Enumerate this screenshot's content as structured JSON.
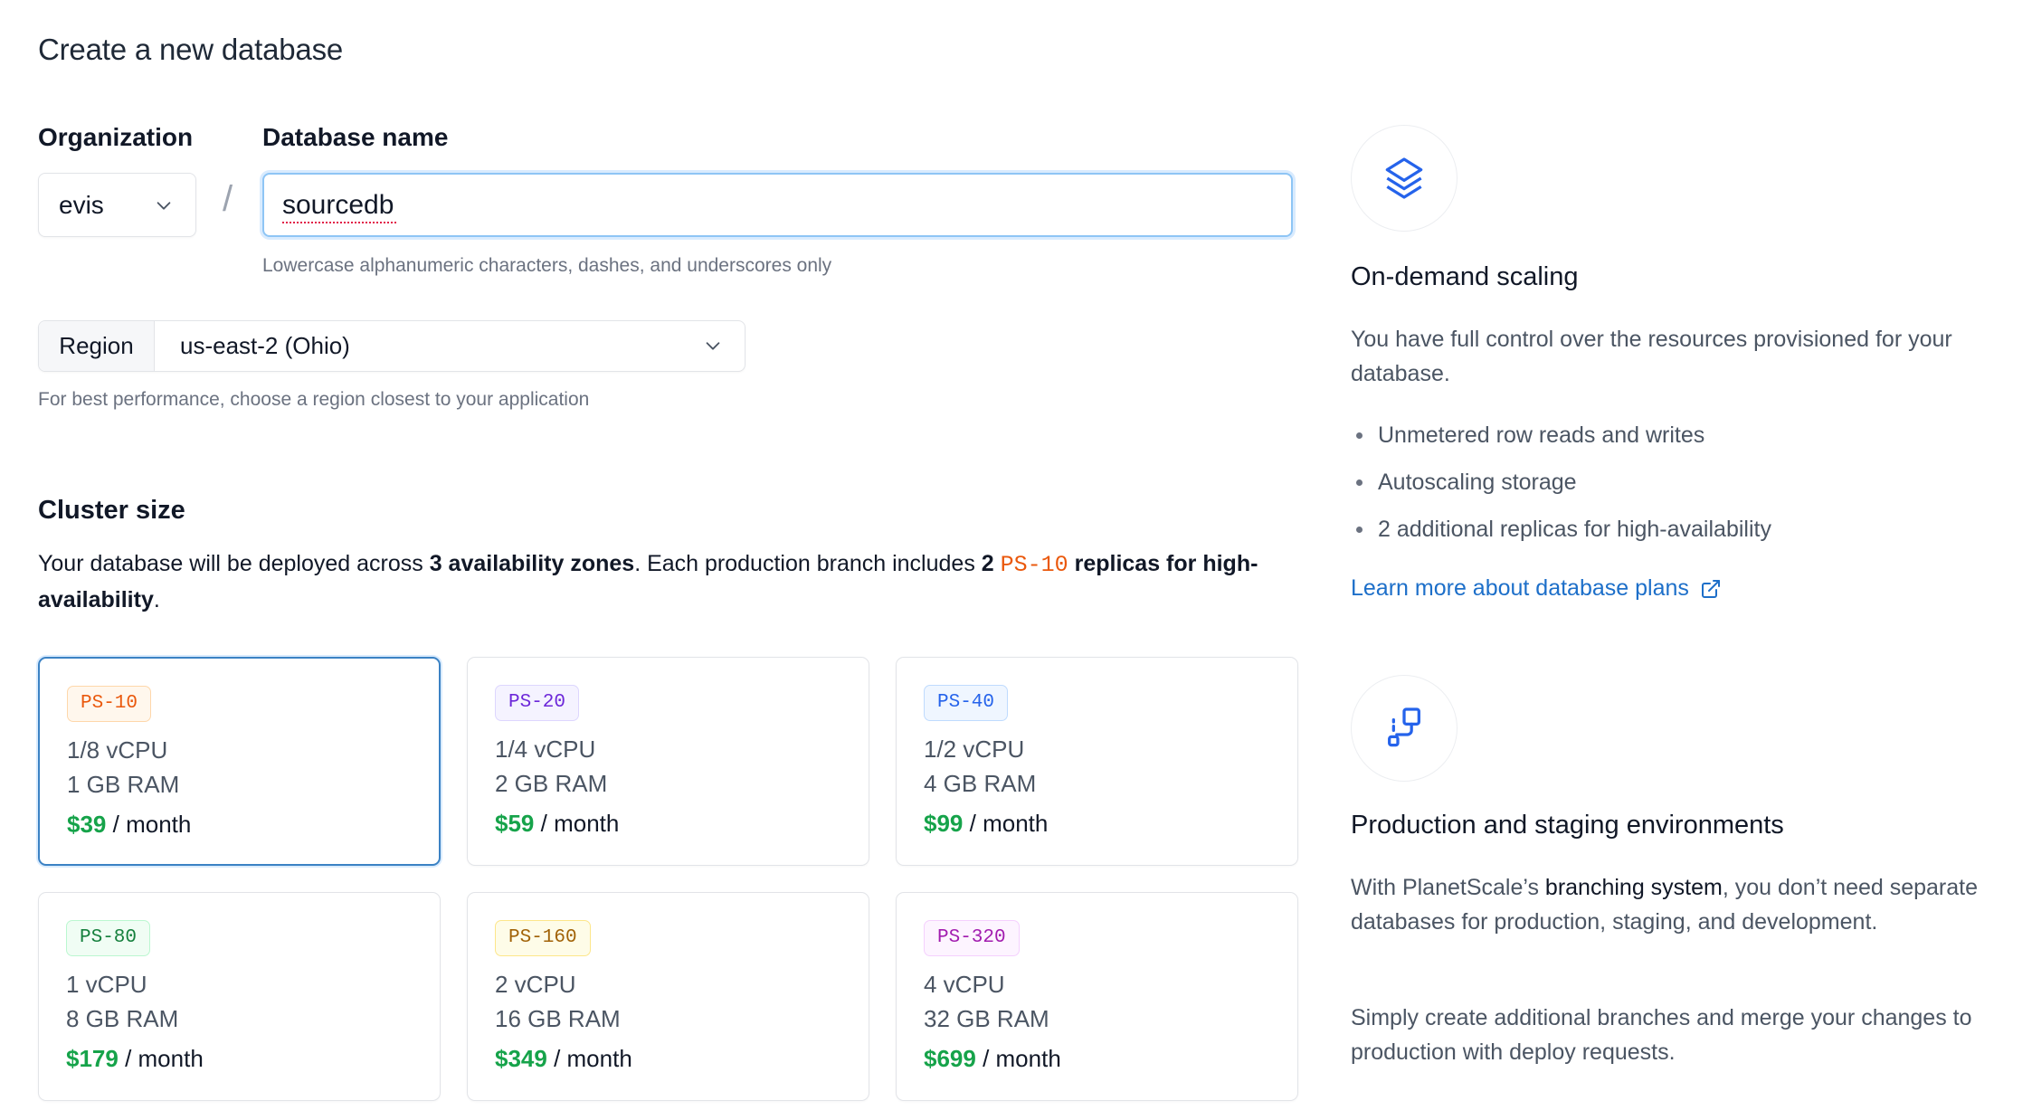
{
  "page": {
    "title": "Create a new database"
  },
  "organization": {
    "label": "Organization",
    "value": "evis"
  },
  "database": {
    "label": "Database name",
    "value": "sourcedb",
    "hint": "Lowercase alphanumeric characters, dashes, and underscores only"
  },
  "region": {
    "label": "Region",
    "value": "us-east-2 (Ohio)",
    "hint": "For best performance, choose a region closest to your application"
  },
  "cluster": {
    "title": "Cluster size",
    "desc_prefix": "Your database will be deployed across ",
    "desc_zones": "3 availability zones",
    "desc_mid": ". Each production branch includes ",
    "desc_replica_count": "2",
    "desc_replica_type": "PS-10",
    "desc_replicas": "replicas for high-availability",
    "desc_end": ".",
    "per_month": "/ month",
    "sizes": [
      {
        "name": "PS-10",
        "cpu": "1/8 vCPU",
        "ram": "1 GB RAM",
        "price": "$39",
        "color": "#ea580c",
        "bg": "#fff7ed",
        "border": "#fed7aa",
        "selected": true
      },
      {
        "name": "PS-20",
        "cpu": "1/4 vCPU",
        "ram": "2 GB RAM",
        "price": "$59",
        "color": "#6d28d9",
        "bg": "#f5f3ff",
        "border": "#ddd6fe",
        "selected": false
      },
      {
        "name": "PS-40",
        "cpu": "1/2 vCPU",
        "ram": "4 GB RAM",
        "price": "$99",
        "color": "#2563eb",
        "bg": "#eff6ff",
        "border": "#bfdbfe",
        "selected": false
      },
      {
        "name": "PS-80",
        "cpu": "1 vCPU",
        "ram": "8 GB RAM",
        "price": "$179",
        "color": "#15803d",
        "bg": "#f0fdf4",
        "border": "#bbf7d0",
        "selected": false
      },
      {
        "name": "PS-160",
        "cpu": "2 vCPU",
        "ram": "16 GB RAM",
        "price": "$349",
        "color": "#a16207",
        "bg": "#fefce8",
        "border": "#fde68a",
        "selected": false
      },
      {
        "name": "PS-320",
        "cpu": "4 vCPU",
        "ram": "32 GB RAM",
        "price": "$699",
        "color": "#a21caf",
        "bg": "#fdf4ff",
        "border": "#f5d0fe",
        "selected": false
      }
    ]
  },
  "features": {
    "scaling": {
      "icon": "layers-icon",
      "title": "On-demand scaling",
      "text": "You have full control over the resources provisioned for your database.",
      "bullets": [
        "Unmetered row reads and writes",
        "Autoscaling storage",
        "2 additional replicas for high-availability"
      ],
      "link": "Learn more about database plans"
    },
    "branching": {
      "icon": "branch-icon",
      "title": "Production and staging environments",
      "text_prefix": "With PlanetScale’s ",
      "text_strong": "branching system",
      "text_suffix": ", you don’t need separate databases for production, staging, and development.",
      "text2": "Simply create additional branches and merge your changes to production with deploy requests."
    }
  },
  "colors": {
    "accent": "#1d6fc9",
    "price": "#16a34a",
    "focus": "#8ec5f5"
  }
}
